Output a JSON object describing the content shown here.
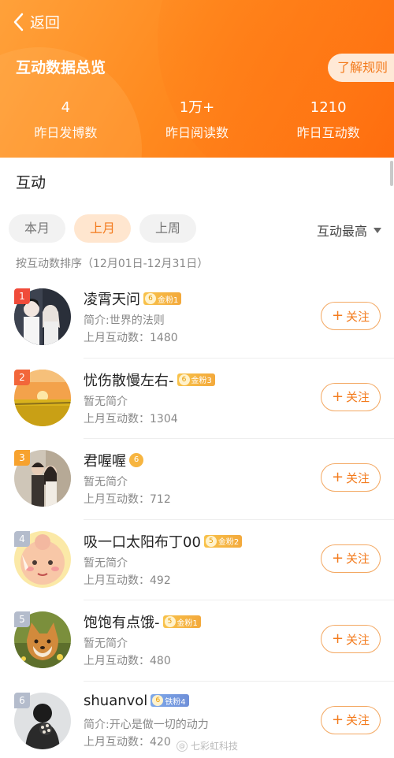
{
  "header": {
    "back_label": "返回",
    "title": "互动数据总览",
    "rules_button": "了解规则",
    "stats": [
      {
        "value": "4",
        "label": "昨日发博数"
      },
      {
        "value": "1万+",
        "label": "昨日阅读数"
      },
      {
        "value": "1210",
        "label": "昨日互动数"
      }
    ]
  },
  "section": {
    "title": "互动",
    "tabs": [
      "本月",
      "上月",
      "上周"
    ],
    "active_tab": "上月",
    "sort_label": "互动最高",
    "subhead": "按互动数排序（12月01日-12月31日）"
  },
  "users": [
    {
      "rank": "1",
      "rank_color": "#f04b3a",
      "name": "凌霄天问",
      "badge_level": "6",
      "badge_text": "金粉1",
      "badge_type": "gold",
      "intro": "简介:世界的法则",
      "count_label": "上月互动数",
      "count": "1480",
      "follow_label": "关注",
      "avatar_icon": "couple-illustration-avatar"
    },
    {
      "rank": "2",
      "rank_color": "#f2663a",
      "name": "忧伤散慢左右-",
      "badge_level": "6",
      "badge_text": "金粉3",
      "badge_type": "gold",
      "intro": "暂无简介",
      "count_label": "上月互动数",
      "count": "1304",
      "follow_label": "关注",
      "avatar_icon": "sunset-field-avatar"
    },
    {
      "rank": "3",
      "rank_color": "#f7a22e",
      "name": "君喔喔",
      "badge_level": "6",
      "badge_text": "",
      "badge_type": "solo",
      "intro": "暂无简介",
      "count_label": "上月互动数",
      "count": "712",
      "follow_label": "关注",
      "avatar_icon": "couple-photo-avatar"
    },
    {
      "rank": "4",
      "rank_color": "#b4bccc",
      "name": "吸一口太阳布丁00",
      "badge_level": "5",
      "badge_text": "金粉2",
      "badge_type": "gold",
      "intro": "暂无简介",
      "count_label": "上月互动数",
      "count": "492",
      "follow_label": "关注",
      "avatar_icon": "cartoon-baby-avatar"
    },
    {
      "rank": "5",
      "rank_color": "#b4bccc",
      "name": "饱饱有点饿-",
      "badge_level": "5",
      "badge_text": "金粉1",
      "badge_type": "gold",
      "intro": "暂无简介",
      "count_label": "上月互动数",
      "count": "480",
      "follow_label": "关注",
      "avatar_icon": "shiba-dog-avatar"
    },
    {
      "rank": "6",
      "rank_color": "#b4bccc",
      "name": "shuanvol",
      "badge_level": "6",
      "badge_text": "铁粉4",
      "badge_type": "iron",
      "intro": "简介:开心是做一切的动力",
      "count_label": "上月互动数",
      "count": "420",
      "follow_label": "关注",
      "avatar_icon": "person-flowers-avatar"
    }
  ],
  "watermark": "七彩虹科技",
  "colors": {
    "accent": "#f37b1d",
    "header_start": "#ffa13a",
    "header_end": "#ff6a0d"
  }
}
